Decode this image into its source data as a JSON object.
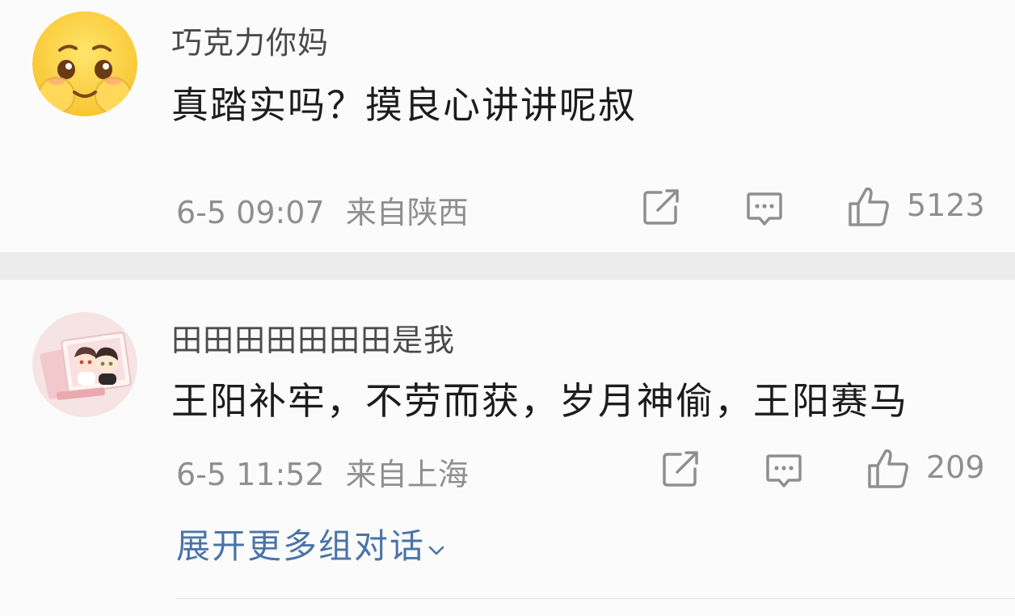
{
  "comments": [
    {
      "username": "巧克力你妈",
      "content": "真踏实吗？摸良心讲讲呢叔",
      "timestamp": "6-5 09:07",
      "location": "来自陕西",
      "like_count": "5123",
      "avatar": "pleading-face-emoji"
    },
    {
      "username": "田田田田田田田是我",
      "content": "王阳补牢，不劳而获，岁月神偷，王阳赛马",
      "timestamp": "6-5 11:52",
      "location": "来自上海",
      "like_count": "209",
      "avatar": "cartoon-couple-photo"
    }
  ],
  "expand_replies_label": "展开更多组对话",
  "colors": {
    "link": "#4a74a8",
    "meta": "#8f8f8f",
    "separator": "#ececec"
  }
}
